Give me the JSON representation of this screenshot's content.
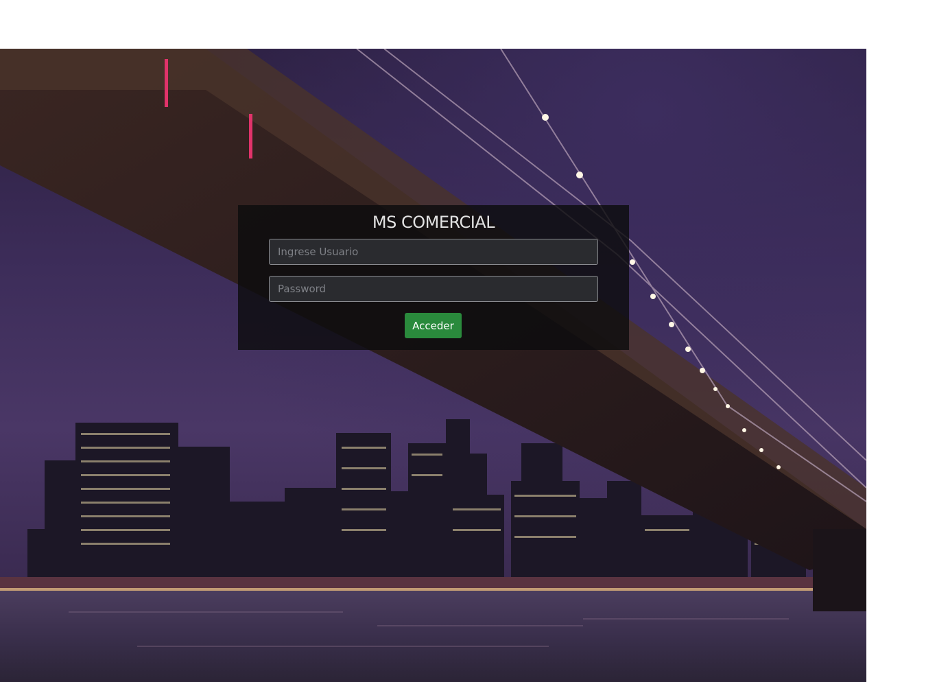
{
  "login": {
    "title": "MS COMERCIAL",
    "username_placeholder": "Ingrese Usuario",
    "username_value": "",
    "password_placeholder": "Password",
    "password_value": "",
    "submit_label": "Acceder"
  },
  "background": {
    "subject": "city-skyline-bridge-night-photo"
  },
  "colors": {
    "panel_bg": "#0c0c0e",
    "button_bg": "#2a8a3c",
    "title_text": "#e2e2e2"
  }
}
